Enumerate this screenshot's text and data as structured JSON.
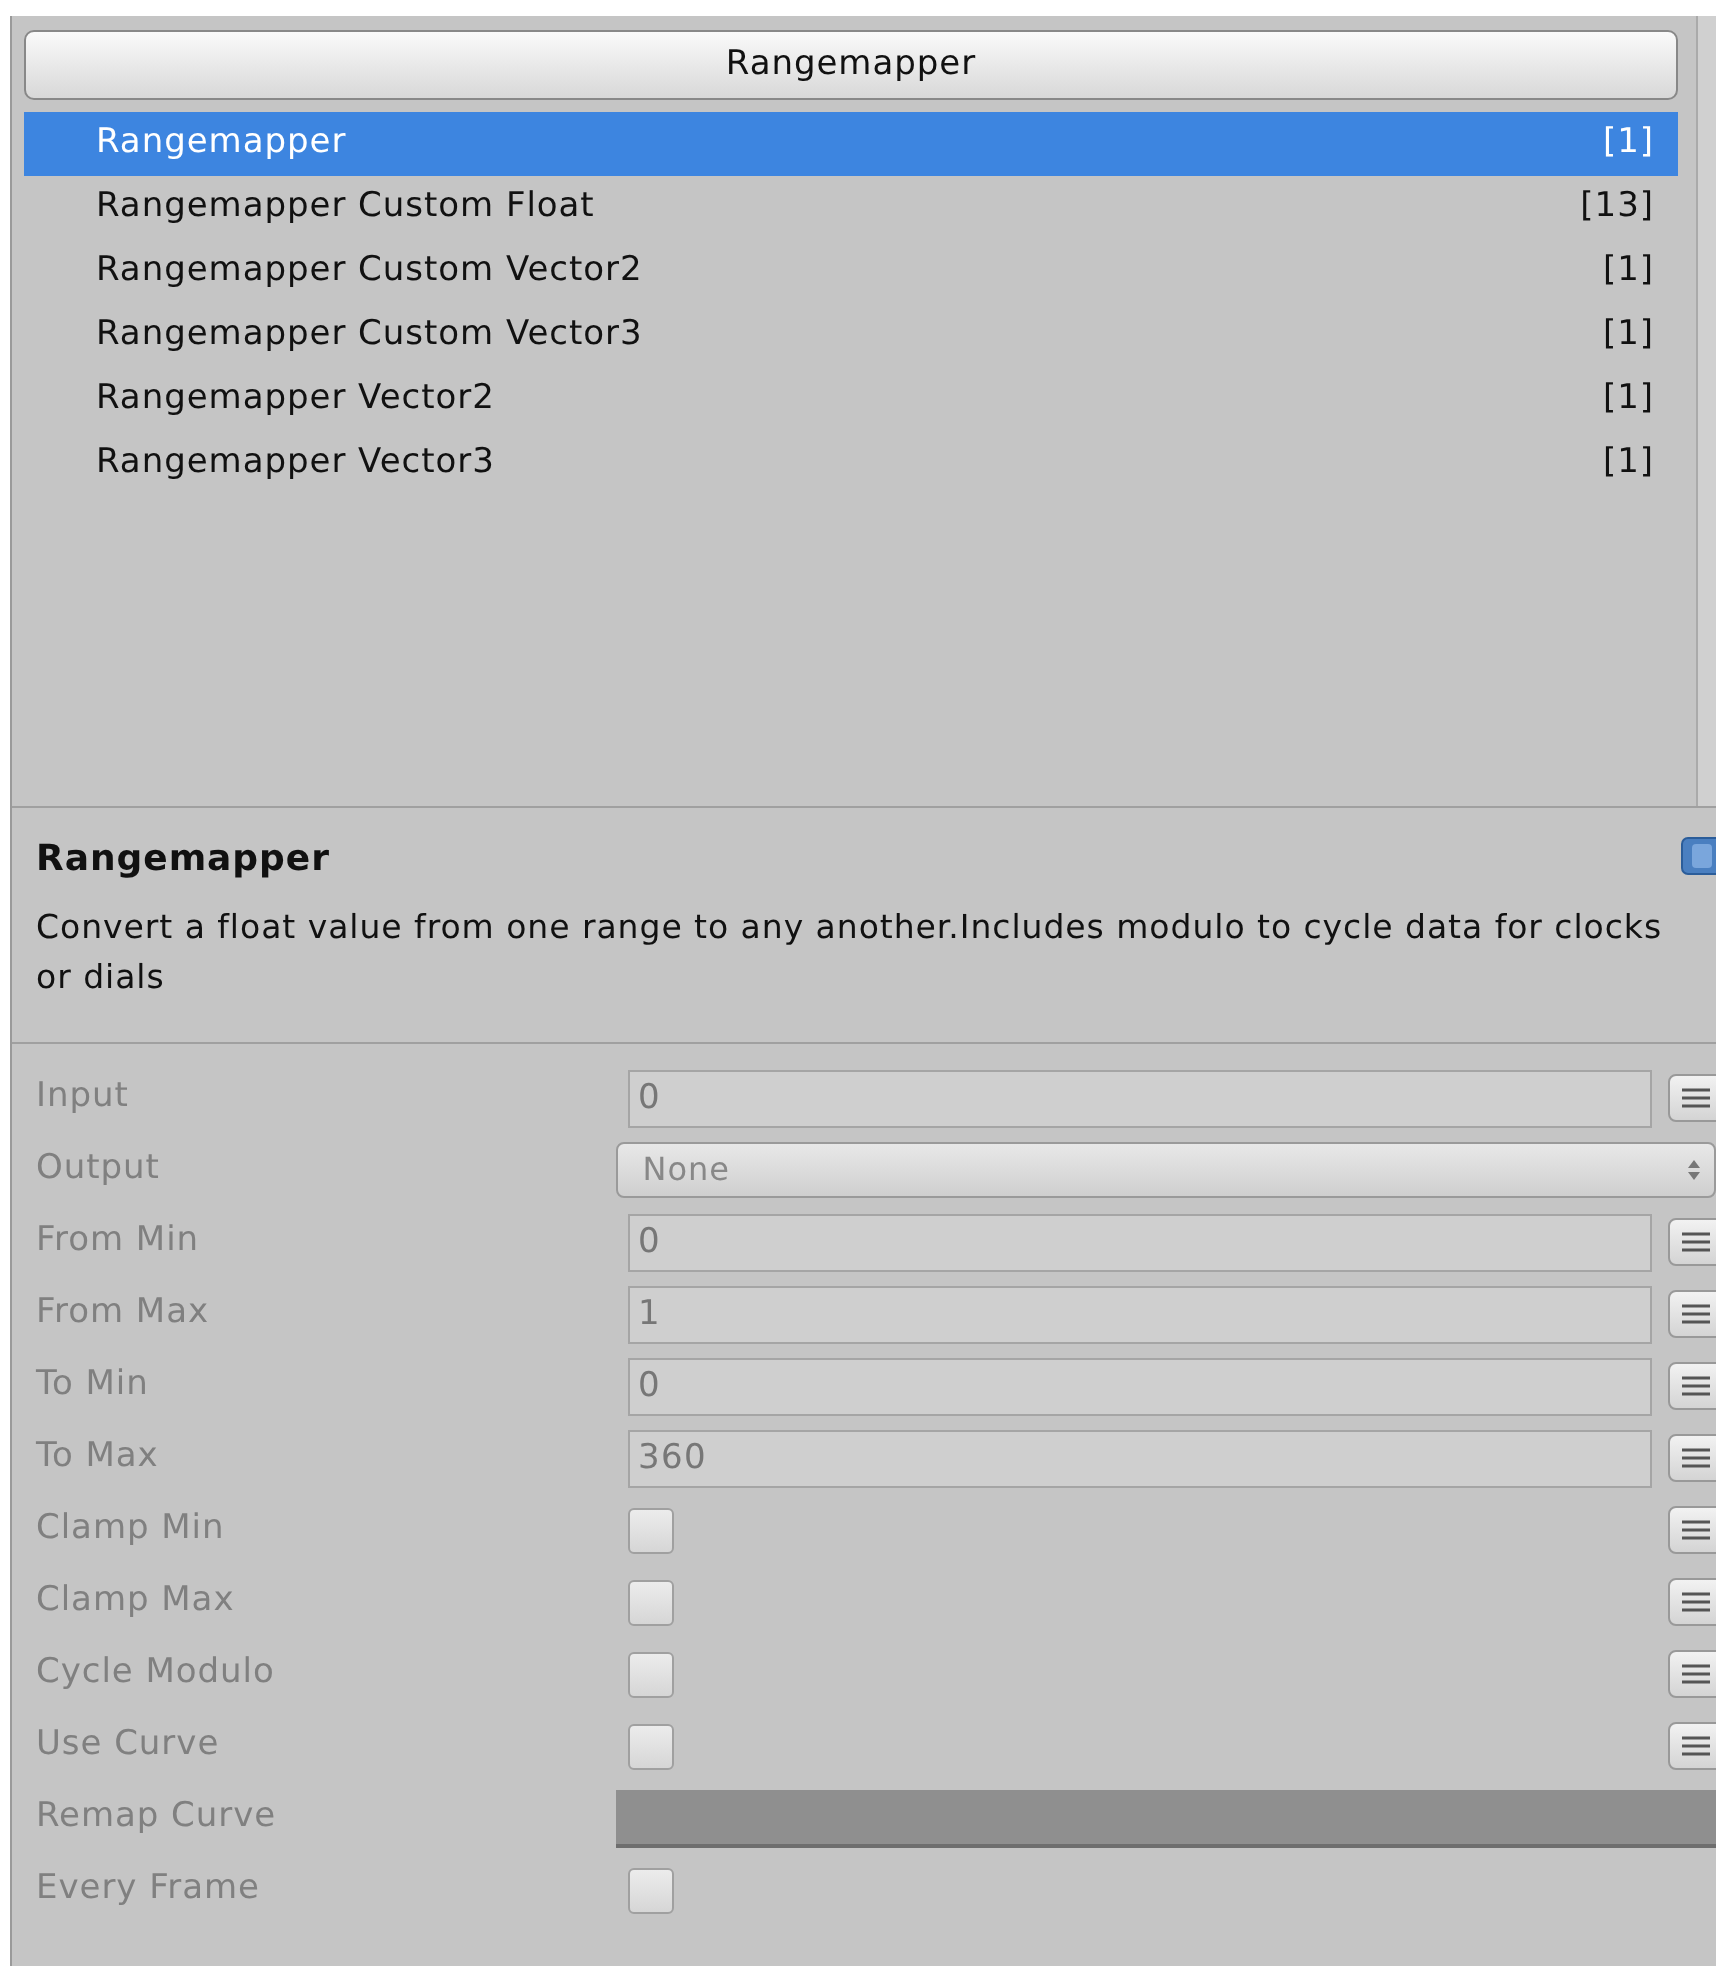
{
  "header_button": "Rangemapper",
  "actions": [
    {
      "name": "Rangemapper",
      "count": "[1]",
      "selected": true
    },
    {
      "name": "Rangemapper Custom Float",
      "count": "[13]",
      "selected": false
    },
    {
      "name": "Rangemapper Custom Vector2",
      "count": "[1]",
      "selected": false
    },
    {
      "name": "Rangemapper Custom Vector3",
      "count": "[1]",
      "selected": false
    },
    {
      "name": "Rangemapper Vector2",
      "count": "[1]",
      "selected": false
    },
    {
      "name": "Rangemapper Vector3",
      "count": "[1]",
      "selected": false
    }
  ],
  "description": {
    "title": "Rangemapper",
    "text": "Convert a float value from one range to any another.Includes modulo to cycle data for clocks or dials"
  },
  "properties": [
    {
      "label": "Input",
      "kind": "number",
      "value": "0",
      "menu_button": true
    },
    {
      "label": "Output",
      "kind": "select",
      "value": "None",
      "menu_button": false
    },
    {
      "label": "From Min",
      "kind": "number",
      "value": "0",
      "menu_button": true
    },
    {
      "label": "From Max",
      "kind": "number",
      "value": "1",
      "menu_button": true
    },
    {
      "label": "To Min",
      "kind": "number",
      "value": "0",
      "menu_button": true
    },
    {
      "label": "To Max",
      "kind": "number",
      "value": "360",
      "menu_button": true
    },
    {
      "label": "Clamp Min",
      "kind": "checkbox",
      "checked": false,
      "menu_button": true
    },
    {
      "label": "Clamp Max",
      "kind": "checkbox",
      "checked": false,
      "menu_button": true
    },
    {
      "label": "Cycle Modulo",
      "kind": "checkbox",
      "checked": false,
      "menu_button": true
    },
    {
      "label": "Use Curve",
      "kind": "checkbox",
      "checked": false,
      "menu_button": true
    },
    {
      "label": "Remap Curve",
      "kind": "curve",
      "menu_button": false
    },
    {
      "label": "Every Frame",
      "kind": "checkbox",
      "checked": false,
      "menu_button": false
    }
  ]
}
